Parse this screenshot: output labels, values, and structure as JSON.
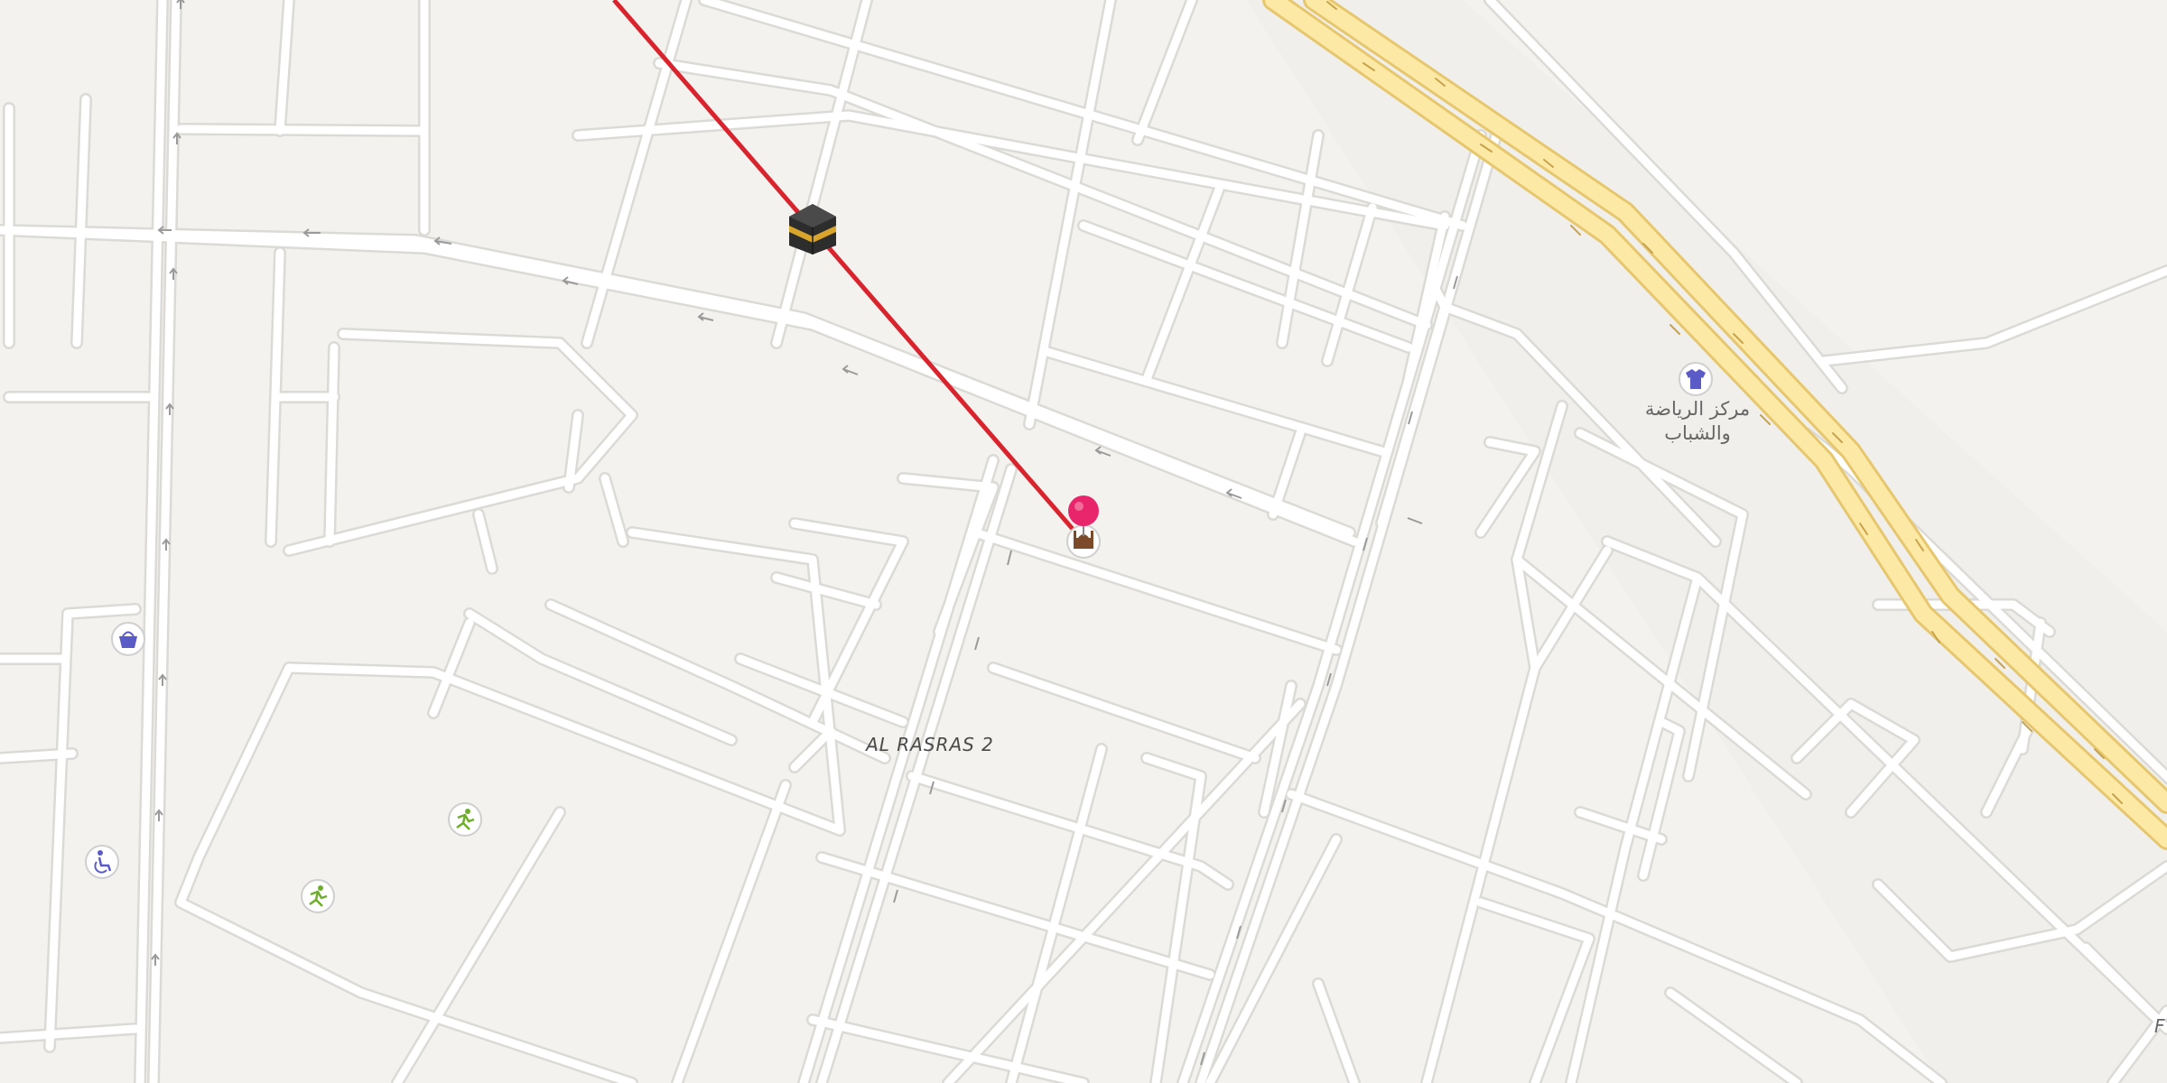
{
  "map": {
    "district_label": "AL RASRAS 2",
    "poi_label": "مركز الرياضة والشباب",
    "edge_label_fragment": "F"
  },
  "markers": [
    {
      "name": "kaaba-icon",
      "icon": "kaaba"
    },
    {
      "name": "pin-icon",
      "icon": "pin",
      "color": "#e8256a"
    },
    {
      "name": "mosque-icon",
      "icon": "mosque"
    },
    {
      "name": "shopping-icon",
      "icon": "basket",
      "color": "#5b5bc8"
    },
    {
      "name": "clothing-store-icon",
      "icon": "shirt",
      "color": "#5b5bc8"
    },
    {
      "name": "sports-icon",
      "icon": "runner",
      "color": "#6fae2c"
    },
    {
      "name": "wheelchair-icon",
      "icon": "wheelchair",
      "color": "#5b5bc8"
    }
  ],
  "colors": {
    "background": "#f4f2ef",
    "road": "#ffffff",
    "road_casing": "#dcdad6",
    "highway_fill": "#fde9a6",
    "highway_casing": "#e6c76e",
    "qibla_line": "#d9232d"
  }
}
